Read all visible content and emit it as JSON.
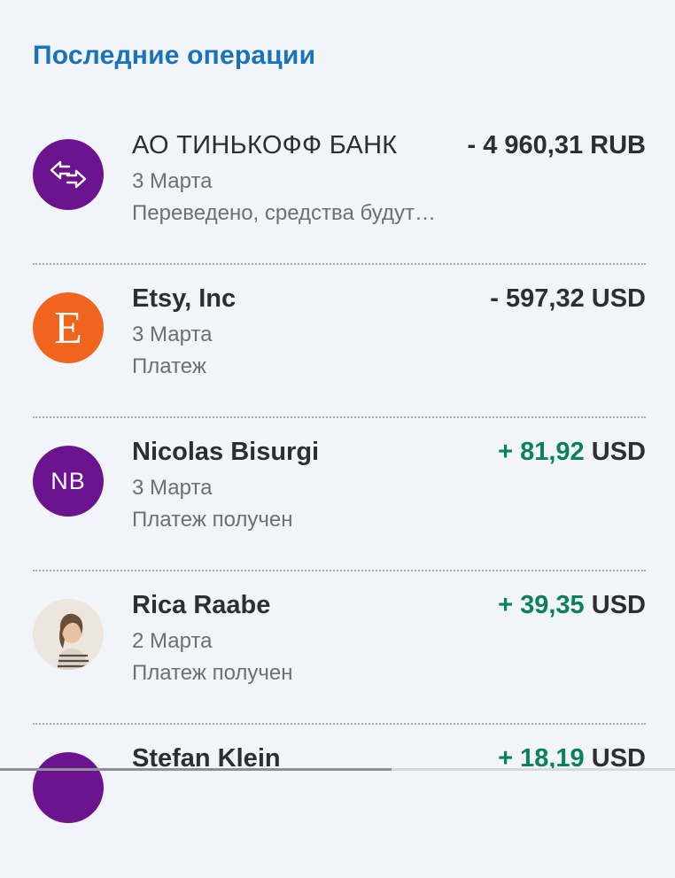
{
  "section": {
    "title": "Последние операции"
  },
  "transactions": [
    {
      "name": "АО ТИНЬКОФФ БАНК",
      "date": "3 Марта",
      "status": "Переведено, средства будут…",
      "amount_sign": "-",
      "amount_value": "- 4 960,31",
      "currency": "RUB",
      "avatar": {
        "type": "icon",
        "icon": "transfer-arrows-icon",
        "color": "#6c148f"
      }
    },
    {
      "name": "Etsy, Inc",
      "date": "3 Марта",
      "status": "Платеж",
      "amount_sign": "-",
      "amount_value": "- 597,32",
      "currency": "USD",
      "avatar": {
        "type": "letter",
        "letter": "E",
        "color": "#f1641e"
      }
    },
    {
      "name": "Nicolas Bisurgi",
      "date": "3 Марта",
      "status": "Платеж получен",
      "amount_sign": "+",
      "amount_value": "+ 81,92",
      "currency": "USD",
      "avatar": {
        "type": "initials",
        "initials": "NB",
        "color": "#6c148f"
      }
    },
    {
      "name": "Rica Raabe",
      "date": "2 Марта",
      "status": "Платеж получен",
      "amount_sign": "+",
      "amount_value": "+ 39,35",
      "currency": "USD",
      "avatar": {
        "type": "photo",
        "icon": "user-photo-avatar"
      }
    },
    {
      "name": "Stefan Klein",
      "date": "",
      "status": "",
      "amount_sign": "+",
      "amount_value": "+ 18,19",
      "currency": "USD",
      "avatar": {
        "type": "initials",
        "initials": "",
        "color": "#6c148f"
      }
    }
  ],
  "colors": {
    "accent": "#1a72b8",
    "positive": "#0a7f61",
    "text_primary": "#2c2e2f",
    "text_secondary": "#687173",
    "background": "#f1f4f8"
  }
}
